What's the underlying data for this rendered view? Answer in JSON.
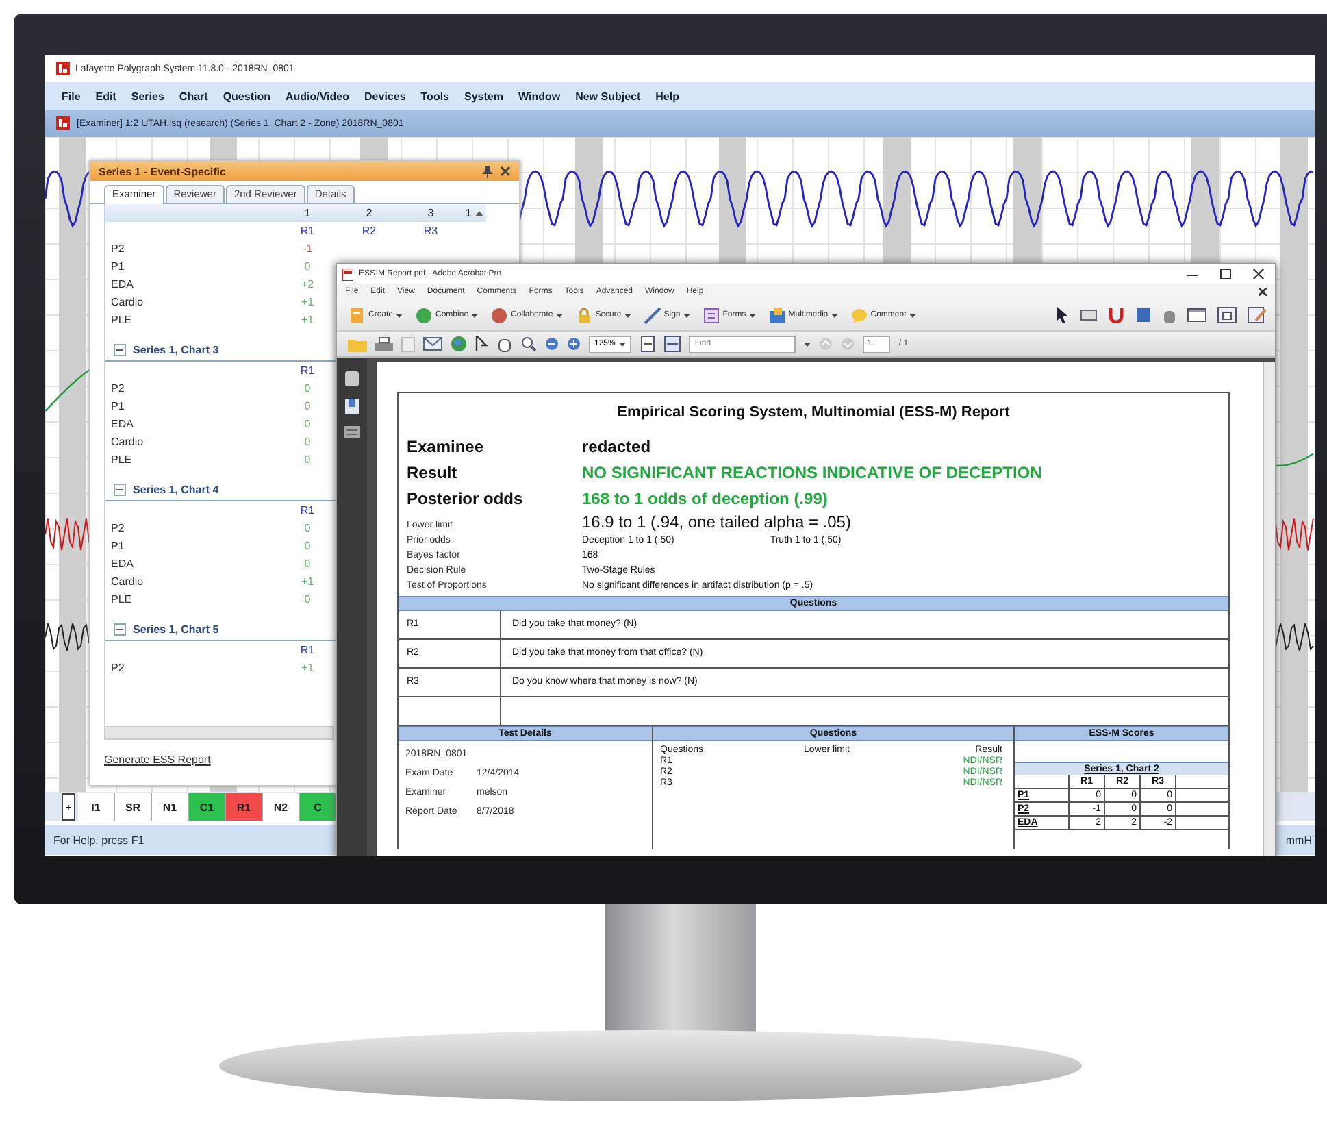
{
  "app": {
    "title": "Lafayette Polygraph System 11.8.0 - 2018RN_0801",
    "menu": [
      "File",
      "Edit",
      "Series",
      "Chart",
      "Question",
      "Audio/Video",
      "Devices",
      "Tools",
      "System",
      "Window",
      "New Subject",
      "Help"
    ],
    "document_title": "[Examiner] 1:2  UTAH.lsq (research) (Series 1, Chart 2 - Zone) 2018RN_0801",
    "expand_button": "+",
    "segments": [
      {
        "label": "I1",
        "color": "#ffffff"
      },
      {
        "label": "SR",
        "color": "#ffffff"
      },
      {
        "label": "N1",
        "color": "#ffffff"
      },
      {
        "label": "C1",
        "color": "#2ec04f"
      },
      {
        "label": "R1",
        "color": "#f04a4a"
      },
      {
        "label": "N2",
        "color": "#ffffff"
      },
      {
        "label": "C",
        "color": "#2ec04f"
      }
    ],
    "status_text": "For Help, press F1",
    "unit_text": "mmH"
  },
  "panel": {
    "title": "Series 1 - Event-Specific",
    "tabs": [
      {
        "label": "Examiner",
        "selected": true
      },
      {
        "label": "Reviewer",
        "selected": false
      },
      {
        "label": "2nd Reviewer",
        "selected": false
      },
      {
        "label": "Details",
        "selected": false
      }
    ],
    "columns": [
      "1",
      "2",
      "3",
      "1"
    ],
    "groups": [
      {
        "questions": [
          "R1",
          "R2",
          "R3"
        ],
        "rows": [
          {
            "label": "P2",
            "scores": [
              {
                "value": "-1",
                "color": "#e8453c"
              }
            ]
          },
          {
            "label": "P1",
            "scores": [
              {
                "value": "0",
                "color": "#5cb85c"
              }
            ]
          },
          {
            "label": "EDA",
            "scores": [
              {
                "value": "+2",
                "color": "#5cb85c"
              }
            ]
          },
          {
            "label": "Cardio",
            "scores": [
              {
                "value": "+1",
                "color": "#5cb85c"
              }
            ]
          },
          {
            "label": "PLE",
            "scores": [
              {
                "value": "+1",
                "color": "#5cb85c"
              }
            ]
          }
        ]
      },
      {
        "title": "Series 1, Chart 3",
        "questions": [
          "R1"
        ],
        "rows": [
          {
            "label": "P2",
            "scores": [
              {
                "value": "0",
                "color": "#5cb85c"
              }
            ]
          },
          {
            "label": "P1",
            "scores": [
              {
                "value": "0",
                "color": "#5cb85c"
              }
            ]
          },
          {
            "label": "EDA",
            "scores": [
              {
                "value": "0",
                "color": "#5cb85c"
              }
            ]
          },
          {
            "label": "Cardio",
            "scores": [
              {
                "value": "0",
                "color": "#5cb85c"
              }
            ]
          },
          {
            "label": "PLE",
            "scores": [
              {
                "value": "0",
                "color": "#5cb85c"
              }
            ]
          }
        ]
      },
      {
        "title": "Series 1, Chart 4",
        "questions": [
          "R1"
        ],
        "rows": [
          {
            "label": "P2",
            "scores": [
              {
                "value": "0",
                "color": "#5cb85c"
              }
            ]
          },
          {
            "label": "P1",
            "scores": [
              {
                "value": "0",
                "color": "#5cb85c"
              }
            ]
          },
          {
            "label": "EDA",
            "scores": [
              {
                "value": "0",
                "color": "#5cb85c"
              }
            ]
          },
          {
            "label": "Cardio",
            "scores": [
              {
                "value": "+1",
                "color": "#5cb85c"
              }
            ]
          },
          {
            "label": "PLE",
            "scores": [
              {
                "value": "0",
                "color": "#5cb85c"
              }
            ]
          }
        ]
      },
      {
        "title": "Series 1, Chart 5",
        "questions": [
          "R1"
        ],
        "rows": [
          {
            "label": "P2",
            "scores": [
              {
                "value": "+1",
                "color": "#5cb85c"
              }
            ]
          }
        ]
      }
    ],
    "link": "Generate ESS Report"
  },
  "acrobat": {
    "title": "ESS-M Report.pdf - Adobe Acrobat Pro",
    "menu": [
      "File",
      "Edit",
      "View",
      "Document",
      "Comments",
      "Forms",
      "Tools",
      "Advanced",
      "Window",
      "Help"
    ],
    "tools": [
      "Create",
      "Combine",
      "Collaborate",
      "Secure",
      "Sign",
      "Forms",
      "Multimedia",
      "Comment"
    ],
    "zoom": "125%",
    "find_placeholder": "Find",
    "page": "1",
    "page_total": "/ 1"
  },
  "report": {
    "title": "Empirical Scoring System, Multinomial (ESS-M) Report",
    "fields": [
      {
        "kind": "heading",
        "label": "Examinee",
        "values": [
          {
            "text": "redacted",
            "color": "#111111"
          }
        ]
      },
      {
        "kind": "heading",
        "label": "Result",
        "values": [
          {
            "text": "NO SIGNIFICANT REACTIONS INDICATIVE OF DECEPTION",
            "color": "#1faa3c"
          }
        ]
      },
      {
        "kind": "heading",
        "label": "Posterior odds",
        "values": [
          {
            "text": "168 to 1 odds of deception (.99)",
            "color": "#1faa3c"
          }
        ]
      },
      {
        "kind": "emphasis",
        "label": "Lower limit",
        "values": [
          {
            "text": "16.9 to 1 (.94, one tailed alpha = .05)",
            "color": "#111111"
          }
        ]
      },
      {
        "kind": "detail",
        "label": "Prior odds",
        "values": [
          {
            "text": "Deception 1 to 1 (.50)",
            "color": "#111111"
          },
          {
            "text": "Truth 1 to 1 (.50)",
            "color": "#111111"
          }
        ]
      },
      {
        "kind": "detail",
        "label": "Bayes factor",
        "values": [
          {
            "text": "168",
            "color": "#111111"
          }
        ]
      },
      {
        "kind": "detail",
        "label": "Decision Rule",
        "values": [
          {
            "text": "Two-Stage Rules",
            "color": "#111111"
          }
        ]
      },
      {
        "kind": "detail",
        "label": "Test of Proportions",
        "values": [
          {
            "text": "No significant differences in artifact distribution (p = .5)",
            "color": "#111111"
          }
        ]
      }
    ],
    "questions_header": "Questions",
    "questions": [
      {
        "id": "R1",
        "text": "Did you take that money? (N)"
      },
      {
        "id": "R2",
        "text": "Did you take that money from that office? (N)"
      },
      {
        "id": "R3",
        "text": "Do you know where that money is now? (N)"
      }
    ],
    "details_header": "Test Details",
    "details": [
      {
        "value": "2018RN_0801"
      },
      {
        "label": "Exam Date",
        "value": "12/4/2014"
      },
      {
        "label": "Examiner",
        "value": "melson"
      },
      {
        "label": "Report Date",
        "value": "8/7/2018"
      }
    ],
    "results_header": "Questions",
    "results_columns": [
      "Questions",
      "Lower limit",
      "Result"
    ],
    "results": [
      {
        "question": "R1",
        "result": "NDI/NSR"
      },
      {
        "question": "R2",
        "result": "NDI/NSR"
      },
      {
        "question": "R3",
        "result": "NDI/NSR"
      }
    ],
    "scores_header": "ESS-M Scores",
    "scores_title": "Series 1, Chart 2",
    "scores_columns": [
      "R1",
      "R2",
      "R3"
    ],
    "scores": [
      {
        "label": "P1",
        "values": [
          "0",
          "0",
          "0"
        ]
      },
      {
        "label": "P2",
        "values": [
          "-1",
          "0",
          "0"
        ]
      },
      {
        "label": "EDA",
        "values": [
          "2",
          "2",
          "-2"
        ]
      }
    ]
  }
}
